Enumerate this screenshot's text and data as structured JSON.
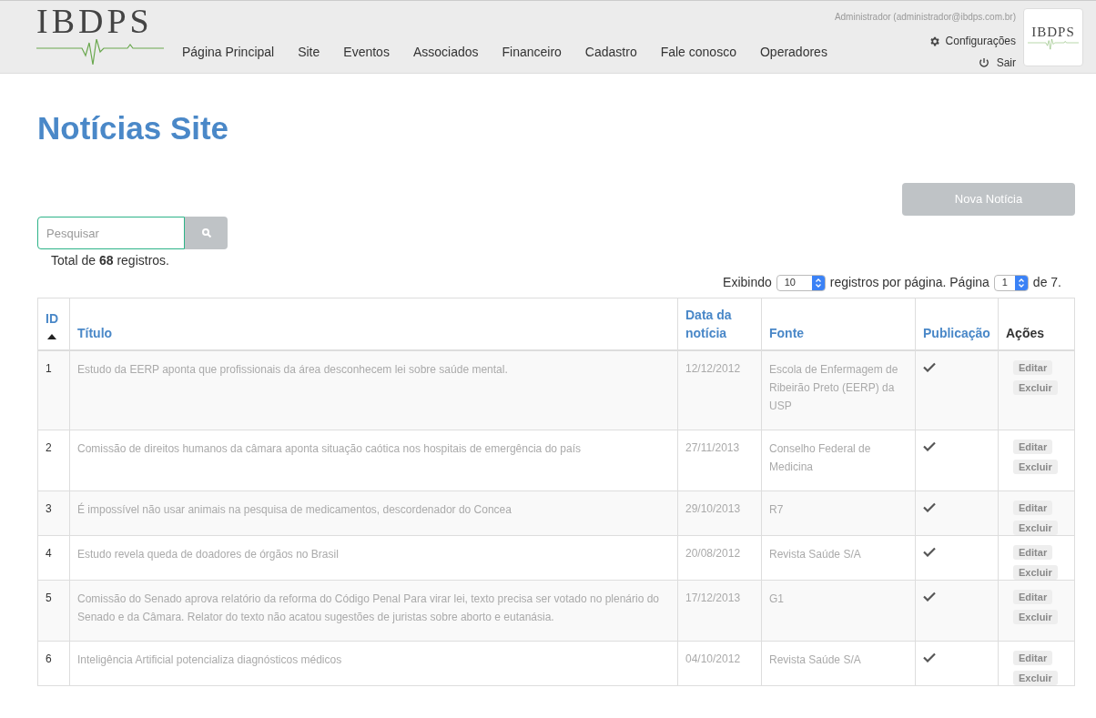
{
  "header": {
    "logo": "IBDPS",
    "nav": [
      {
        "label": "Página Principal"
      },
      {
        "label": "Site"
      },
      {
        "label": "Eventos"
      },
      {
        "label": "Associados"
      },
      {
        "label": "Financeiro"
      },
      {
        "label": "Cadastro"
      },
      {
        "label": "Fale conosco"
      },
      {
        "label": "Operadores"
      }
    ],
    "user": "Administrador (administrador@ibdps.com.br)",
    "settings": "Configurações",
    "logout": "Sair",
    "badge_logo": "IBDPS"
  },
  "page": {
    "title": "Notícias Site",
    "new_button": "Nova Notícia",
    "search": {
      "placeholder": "Pesquisar"
    },
    "total": {
      "before": "Total de",
      "count": "68",
      "after": "registros."
    },
    "pagination": {
      "showing": "Exibindo",
      "per_page": "10",
      "per_page_label": "registros por página. Página",
      "page": "1",
      "of": "de 7."
    }
  },
  "table": {
    "columns": [
      {
        "label": "ID",
        "sorted": true,
        "link": true
      },
      {
        "label": "Título",
        "sorted": false,
        "link": true
      },
      {
        "label": "Data da notícia",
        "sorted": false,
        "link": true
      },
      {
        "label": "Fonte",
        "sorted": false,
        "link": true
      },
      {
        "label": "Publicação",
        "sorted": false,
        "link": true
      },
      {
        "label": "Ações",
        "sorted": false,
        "link": false
      }
    ],
    "rows": [
      {
        "id": "1",
        "title": "Estudo da EERP aponta que profissionais da área desconhecem lei sobre saúde mental.",
        "date": "12/12/2012",
        "source": "Escola de Enfermagem de Ribeirão Preto (EERP) da USP",
        "published": true,
        "actions": [
          "Editar",
          "Excluir"
        ]
      },
      {
        "id": "2",
        "title": "Comissão de direitos humanos da câmara aponta situação caótica nos hospitais de emergência do país",
        "date": "27/11/2013",
        "source": "Conselho Federal de Medicina",
        "published": true,
        "actions": [
          "Editar",
          "Excluir"
        ]
      },
      {
        "id": "3",
        "title": "É impossível não usar animais na pesquisa de medicamentos, descordenador do Concea",
        "date": "29/10/2013",
        "source": "R7",
        "published": true,
        "actions": [
          "Editar",
          "Excluir"
        ]
      },
      {
        "id": "4",
        "title": "Estudo revela queda de doadores de órgãos no Brasil",
        "date": "20/08/2012",
        "source": "Revista Saúde S/A",
        "published": true,
        "actions": [
          "Editar",
          "Excluir"
        ]
      },
      {
        "id": "5",
        "title": "Comissão do Senado aprova relatório da reforma do Código Penal Para virar lei, texto precisa ser votado no plenário do Senado e da Câmara. Relator do texto não acatou sugestões de juristas sobre aborto e eutanásia.",
        "date": "17/12/2013",
        "source": "G1",
        "published": true,
        "actions": [
          "Editar",
          "Excluir"
        ]
      },
      {
        "id": "6",
        "title": "Inteligência Artificial potencializa diagnósticos médicos",
        "date": "04/10/2012",
        "source": "Revista Saúde S/A",
        "published": true,
        "actions": [
          "Editar",
          "Excluir"
        ]
      }
    ]
  }
}
